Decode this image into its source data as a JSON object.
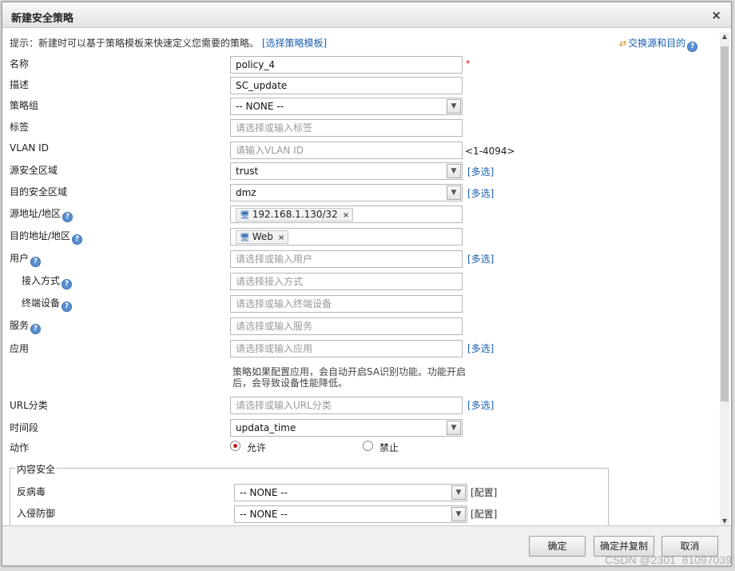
{
  "dialog": {
    "title": "新建安全策略",
    "close": "×"
  },
  "hint": {
    "text": "提示：新建时可以基于策略模板来快速定义您需要的策略。",
    "link": "[选择策略模板]",
    "swap": "交换源和目的"
  },
  "help_glyph": "?",
  "multi_label": "[多选]",
  "fields": {
    "name": {
      "label": "名称",
      "value": "policy_4",
      "required": "*"
    },
    "description": {
      "label": "描述",
      "value": "SC_update"
    },
    "policy_group": {
      "label": "策略组",
      "value": "-- NONE --"
    },
    "tag": {
      "label": "标签",
      "placeholder": "请选择或输入标签"
    },
    "vlan_id": {
      "label": "VLAN ID",
      "placeholder": "请输入VLAN ID",
      "range": "<1-4094>"
    },
    "src_zone": {
      "label": "源安全区域",
      "value": "trust"
    },
    "dst_zone": {
      "label": "目的安全区域",
      "value": "dmz"
    },
    "src_addr": {
      "label": "源地址/地区",
      "tag": "192.168.1.130/32"
    },
    "dst_addr": {
      "label": "目的地址/地区",
      "tag": "Web"
    },
    "user": {
      "label": "用户",
      "placeholder": "请选择或输入用户"
    },
    "access_mode": {
      "label": "接入方式",
      "placeholder": "请选择接入方式"
    },
    "terminal": {
      "label": "终端设备",
      "placeholder": "请选择或输入终端设备"
    },
    "service": {
      "label": "服务",
      "placeholder": "请选择或输入服务"
    },
    "application": {
      "label": "应用",
      "placeholder": "请选择或输入应用"
    },
    "app_note_1": "策略如果配置应用，会自动开启SA识别功能。功能开启",
    "app_note_2": "后，会导致设备性能降低。",
    "url_category": {
      "label": "URL分类",
      "placeholder": "请选择或输入URL分类"
    },
    "time_range": {
      "label": "时间段",
      "value": "updata_time"
    },
    "action": {
      "label": "动作",
      "allow": "允许",
      "deny": "禁止",
      "selected": "allow"
    }
  },
  "content_security": {
    "legend": "内容安全",
    "antivirus": {
      "label": "反病毒",
      "value": "-- NONE --",
      "config": "[配置]"
    },
    "ips": {
      "label": "入侵防御",
      "value": "-- NONE --",
      "config": "[配置]"
    }
  },
  "buttons": {
    "ok": "确定",
    "ok_copy": "确定并复制",
    "cancel": "取消"
  },
  "watermark": "CSDN @2301_81097039"
}
